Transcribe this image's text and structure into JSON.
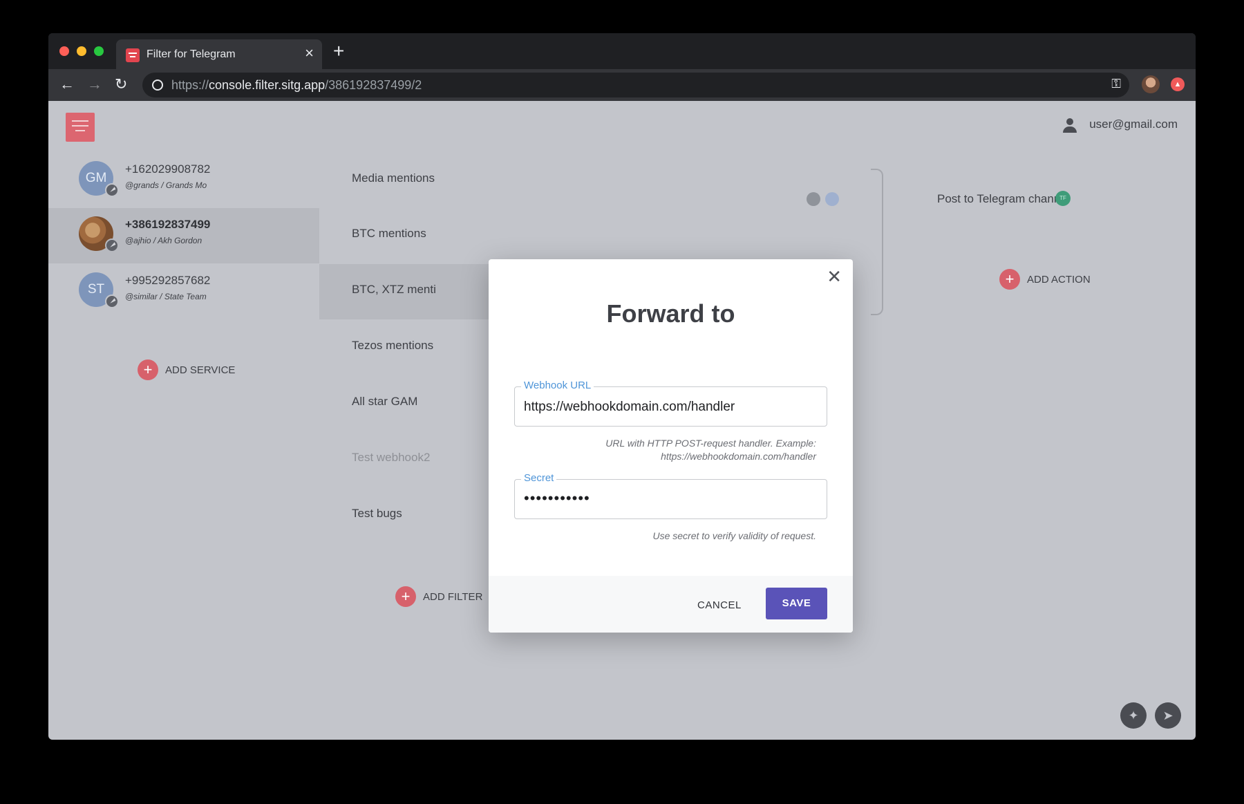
{
  "browser": {
    "tab_title": "Filter for Telegram",
    "url_scheme": "https://",
    "url_host": "console.filter.sitg.app",
    "url_path": "/386192837499/2"
  },
  "header": {
    "user_email": "user@gmail.com"
  },
  "services": [
    {
      "initials": "GM",
      "phone": "+162029908782",
      "handle": "@grands / Grands Mo"
    },
    {
      "initials": "",
      "phone": "+386192837499",
      "handle": "@ajhio / Akh Gordon"
    },
    {
      "initials": "ST",
      "phone": "+995292857682",
      "handle": "@similar / State Team"
    }
  ],
  "add_service_label": "ADD SERVICE",
  "filters": [
    {
      "label": "Media mentions"
    },
    {
      "label": "BTC mentions"
    },
    {
      "label": "BTC, XTZ menti"
    },
    {
      "label": "Tezos mentions"
    },
    {
      "label": "All star GAM"
    },
    {
      "label": "Test webhook2"
    },
    {
      "label": "Test bugs"
    }
  ],
  "add_filter_label": "ADD FILTER",
  "actions": {
    "post_label": "Post to Telegram channel",
    "badge": "TF",
    "add_action_label": "ADD ACTION"
  },
  "modal": {
    "title": "Forward to",
    "webhook_label": "Webhook URL",
    "webhook_value": "https://webhookdomain.com/handler",
    "webhook_help_line1": "URL with HTTP POST-request handler. Example:",
    "webhook_help_line2": "https://webhookdomain.com/handler",
    "secret_label": "Secret",
    "secret_value": "•••••••••••",
    "secret_help": "Use secret to verify validity of request.",
    "cancel_label": "CANCEL",
    "save_label": "SAVE"
  },
  "colors": {
    "accent": "#5a53b8",
    "brand": "#dc6670",
    "label_blue": "#4f95d8"
  }
}
